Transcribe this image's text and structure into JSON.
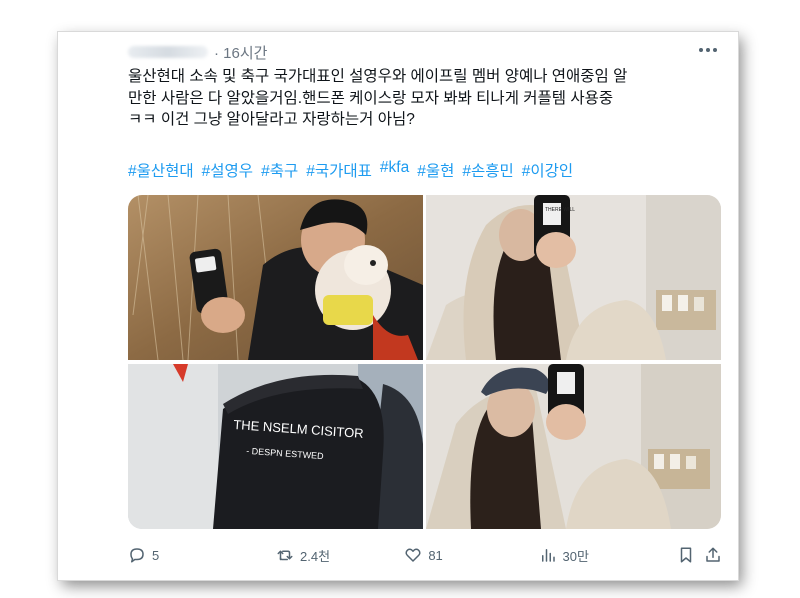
{
  "tweet": {
    "time": "· 16시간",
    "text": "울산현대 소속 및 축구 국가대표인 설영우와 에이프릴 멤버 양예나 연애중임 알\n만한 사람은 다 알았을거임.핸드폰 케이스랑 모자 봐봐 티나게 커플템 사용중\nㅋㅋ 이건 그냥 알아달라고 자랑하는거 아님?",
    "hashtags": [
      "#울산현대",
      "#설영우",
      "#축구",
      "#국가대표",
      "#kfa",
      "#울현",
      "#손흥민",
      "#이강인"
    ]
  },
  "photos": {
    "cap_text_line1": "THE NSELM CISITOR",
    "cap_text_line2": "- DESPN ESTWED",
    "phone_case_text": "THERE WILL"
  },
  "actions": {
    "replies": "5",
    "retweets": "2.4천",
    "likes": "81",
    "views": "30만"
  },
  "colors": {
    "accent": "#1d9bf0",
    "text": "#0f1419",
    "muted": "#536471"
  }
}
